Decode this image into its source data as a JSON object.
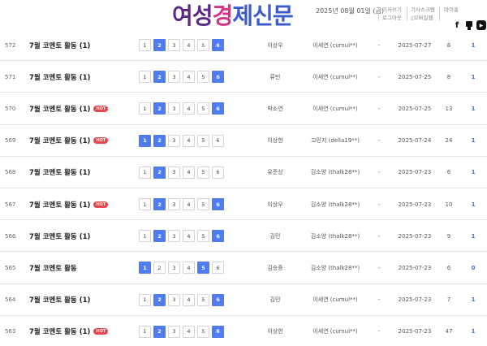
{
  "header": {
    "logo_part1": "여성",
    "logo_part2": "경",
    "logo_part3": "제신문",
    "date": "2025년 08월 01일 (금)",
    "links": [
      {
        "top": "기사쓰기",
        "bottom": "로그아웃"
      },
      {
        "top": "기사스크랩",
        "bottom": "모바일웹"
      },
      {
        "top": "마이홈",
        "bottom": ""
      }
    ],
    "social": {
      "facebook": "f",
      "kakao": "k",
      "youtube": "▶"
    }
  },
  "rows": [
    {
      "num": "572",
      "title": "7월 코멘토 활동 (1)",
      "hot": "",
      "pages": [
        "1",
        "2",
        "3",
        "4",
        "5",
        "6"
      ],
      "active": [
        2,
        6
      ],
      "writer": "이상우",
      "editor": "이세연 (cumul**)",
      "dash": "-",
      "date": "2025-07-27",
      "views": "8",
      "comments": "1"
    },
    {
      "num": "571",
      "title": "7월 코멘토 활동 (1)",
      "hot": "",
      "pages": [
        "1",
        "2",
        "3",
        "4",
        "5",
        "6"
      ],
      "active": [
        2,
        6
      ],
      "writer": "류빈",
      "editor": "이세연 (cumul**)",
      "dash": "-",
      "date": "2025-07-25",
      "views": "8",
      "comments": "1"
    },
    {
      "num": "570",
      "title": "7월 코멘토 활동 (1)",
      "hot": "HOT",
      "pages": [
        "1",
        "2",
        "3",
        "4",
        "5",
        "6"
      ],
      "active": [
        2,
        6
      ],
      "writer": "박소연",
      "editor": "이세연 (cumul**)",
      "dash": "-",
      "date": "2025-07-25",
      "views": "13",
      "comments": "1"
    },
    {
      "num": "569",
      "title": "7월 코멘토 활동 (1)",
      "hot": "HOT",
      "pages": [
        "1",
        "2",
        "3",
        "4",
        "5",
        "6"
      ],
      "active": [
        1,
        2
      ],
      "writer": "이상헌",
      "editor": "고민지 (della19**)",
      "dash": "-",
      "date": "2025-07-24",
      "views": "24",
      "comments": "1"
    },
    {
      "num": "568",
      "title": "7월 코멘토 활동 (1)",
      "hot": "",
      "pages": [
        "1",
        "2",
        "3",
        "4",
        "5",
        "6"
      ],
      "active": [
        2
      ],
      "writer": "유준상",
      "editor": "김소양 (thalk28**)",
      "dash": "-",
      "date": "2025-07-23",
      "views": "6",
      "comments": "1"
    },
    {
      "num": "567",
      "title": "7월 코멘토 활동 (1)",
      "hot": "HOT",
      "pages": [
        "1",
        "2",
        "3",
        "4",
        "5",
        "6"
      ],
      "active": [
        2,
        6
      ],
      "writer": "이상우",
      "editor": "김소양 (thalk28**)",
      "dash": "-",
      "date": "2025-07-23",
      "views": "10",
      "comments": "1"
    },
    {
      "num": "566",
      "title": "7월 코멘토 활동 (1)",
      "hot": "",
      "pages": [
        "1",
        "2",
        "3",
        "4",
        "5",
        "6"
      ],
      "active": [
        2,
        6
      ],
      "writer": "김민",
      "editor": "김소양 (thalk28**)",
      "dash": "-",
      "date": "2025-07-23",
      "views": "9",
      "comments": "1"
    },
    {
      "num": "565",
      "title": "7월 코멘토 활동",
      "hot": "",
      "pages": [
        "1",
        "2",
        "3",
        "4",
        "5",
        "6"
      ],
      "active": [
        1,
        5
      ],
      "writer": "김승중",
      "editor": "김소양 (thalk28**)",
      "dash": "-",
      "date": "2025-07-23",
      "views": "6",
      "comments": "0"
    },
    {
      "num": "564",
      "title": "7월 코멘토 활동 (1)",
      "hot": "",
      "pages": [
        "1",
        "2",
        "3",
        "4",
        "5",
        "6"
      ],
      "active": [
        2,
        6
      ],
      "writer": "김민",
      "editor": "이세연 (cumul**)",
      "dash": "-",
      "date": "2025-07-23",
      "views": "7",
      "comments": "1"
    },
    {
      "num": "563",
      "title": "7월 코멘토 활동 (1)",
      "hot": "HOT",
      "pages": [
        "1",
        "2",
        "3",
        "4",
        "5",
        "6"
      ],
      "active": [
        2,
        6
      ],
      "writer": "이상헌",
      "editor": "이세연 (cumul**)",
      "dash": "-",
      "date": "2025-07-23",
      "views": "47",
      "comments": "1"
    }
  ]
}
